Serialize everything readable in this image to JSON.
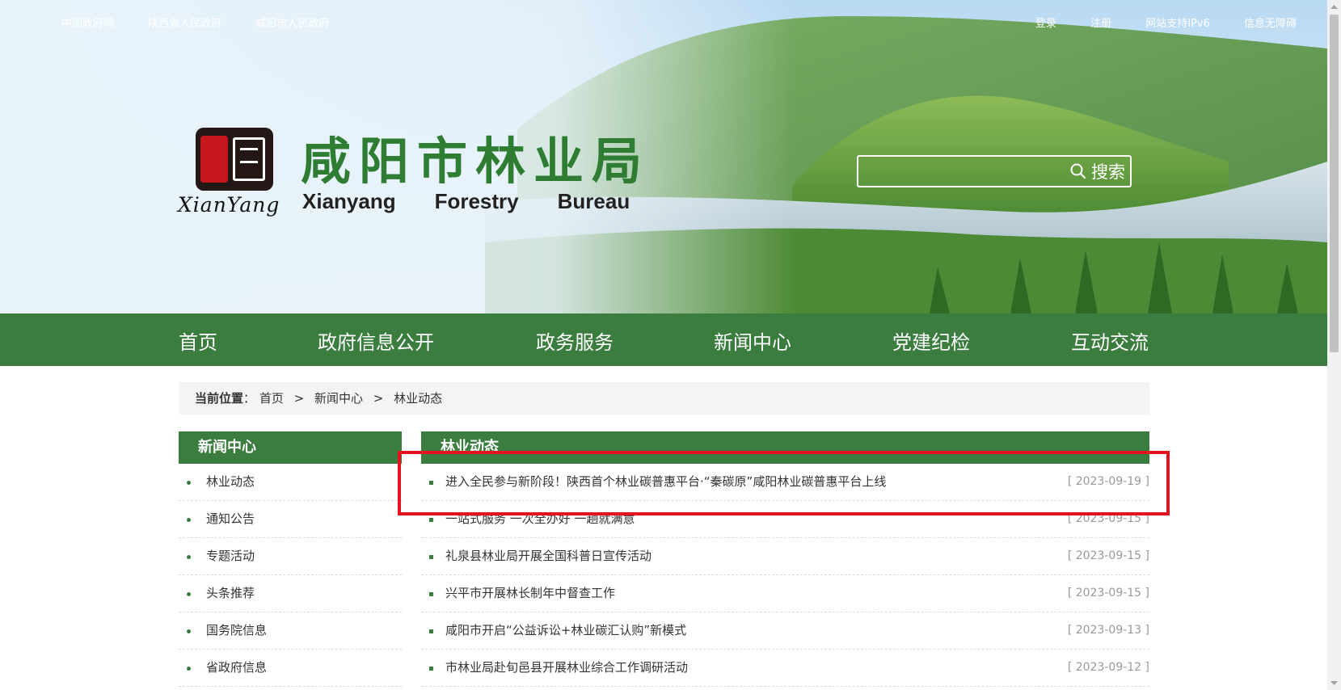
{
  "top_links_left": [
    "中国政府网",
    "陕西省人民政府",
    "咸阳市人民政府"
  ],
  "top_links_right": [
    "登录",
    "注册",
    "网站支持IPv6",
    "信息无障碍"
  ],
  "logo": {
    "cn_title": "咸阳市林业局",
    "en_words": [
      "Xianyang",
      "Forestry",
      "Bureau"
    ],
    "script_text": "XianYang"
  },
  "search": {
    "button_label": "搜索",
    "placeholder": ""
  },
  "nav": [
    "首页",
    "政府信息公开",
    "政务服务",
    "新闻中心",
    "党建纪检",
    "互动交流"
  ],
  "breadcrumb": {
    "label": "当前位置",
    "colon": "：",
    "items": [
      "首页",
      "新闻中心",
      "林业动态"
    ],
    "separator": ">"
  },
  "sidebar": {
    "title": "新闻中心",
    "items": [
      "林业动态",
      "通知公告",
      "专题活动",
      "头条推荐",
      "国务院信息",
      "省政府信息"
    ]
  },
  "main": {
    "title": "林业动态",
    "rows": [
      {
        "title": "进入全民参与新阶段！陕西首个林业碳普惠平台·“秦碳原”咸阳林业碳普惠平台上线",
        "date": "[ 2023-09-19 ]"
      },
      {
        "title": "一站式服务 一次全办好 一趟就满意",
        "date": "[ 2023-09-15 ]"
      },
      {
        "title": "礼泉县林业局开展全国科普日宣传活动",
        "date": "[ 2023-09-15 ]"
      },
      {
        "title": "兴平市开展林长制年中督查工作",
        "date": "[ 2023-09-15 ]"
      },
      {
        "title": "咸阳市开启“公益诉讼+林业碳汇认购”新模式",
        "date": "[ 2023-09-13 ]"
      },
      {
        "title": "市林业局赴旬邑县开展林业综合工作调研活动",
        "date": "[ 2023-09-12 ]"
      }
    ]
  },
  "colors": {
    "brand_green": "#3b7d3e",
    "logo_green": "#2e7d32",
    "highlight_red": "#e3141f",
    "date_gray": "#999999"
  }
}
